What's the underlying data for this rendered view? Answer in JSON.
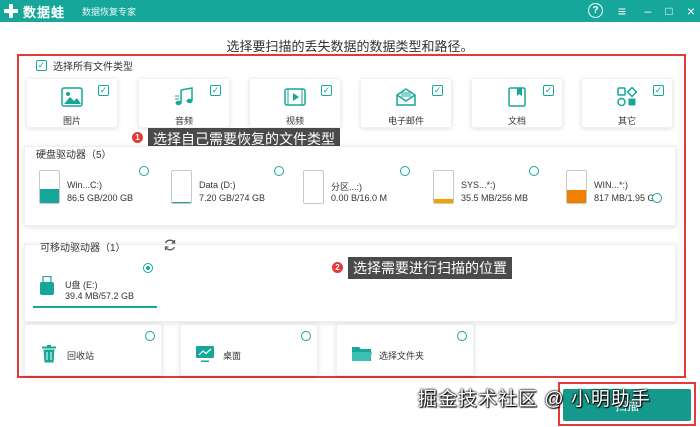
{
  "app": {
    "title": "数据蛙",
    "subtitle": "数据恢复专家"
  },
  "window_controls": {
    "help": "?",
    "menu": "≡",
    "minimize": "–",
    "maximize": "□",
    "close": "×"
  },
  "heading": "选择要扫描的丢失数据的数据类型和路径。",
  "select_all": {
    "label": "选择所有文件类型",
    "checked": true
  },
  "file_types": [
    {
      "label": "图片",
      "icon": "image-icon",
      "checked": true
    },
    {
      "label": "音频",
      "icon": "music-icon",
      "checked": true
    },
    {
      "label": "视频",
      "icon": "video-icon",
      "checked": true
    },
    {
      "label": "电子邮件",
      "icon": "email-icon",
      "checked": true
    },
    {
      "label": "文档",
      "icon": "document-icon",
      "checked": true
    },
    {
      "label": "其它",
      "icon": "other-icon",
      "checked": true
    }
  ],
  "annotation1": {
    "badge": "1",
    "text": "选择自己需要恢复的文件类型"
  },
  "annotation2": {
    "badge": "2",
    "text": "选择需要进行扫描的位置"
  },
  "hard_drives": {
    "title": "硬盘驱动器（5）",
    "items": [
      {
        "name": "Win...C:)",
        "size": "86.5 GB/200 GB",
        "fill": 0.43,
        "color": "#16a79a"
      },
      {
        "name": "Data (D:)",
        "size": "7.20 GB/274 GB",
        "fill": 0.03,
        "color": "#16a79a"
      },
      {
        "name": "分区...:)",
        "size": "0.00  B/16.0 M",
        "fill": 0.0,
        "color": "#16a79a"
      },
      {
        "name": "SYS...*:)",
        "size": "35.5 MB/256 MB",
        "fill": 0.14,
        "color": "#f5a000"
      },
      {
        "name": "WIN...*:)",
        "size": "817 MB/1.95 GB",
        "fill": 0.41,
        "color": "#f08000"
      }
    ]
  },
  "removable": {
    "title": "可移动驱动器（1）",
    "items": [
      {
        "name": "U盘 (E:)",
        "size": "39.4 MB/57.2 GB",
        "selected": true
      }
    ]
  },
  "locations": [
    {
      "label": "回收站",
      "icon": "recycle-bin-icon"
    },
    {
      "label": "桌面",
      "icon": "desktop-icon"
    },
    {
      "label": "选择文件夹",
      "icon": "folder-icon"
    }
  ],
  "watermark": "掘金技术社区 @ 小明助手",
  "scan_button": {
    "label": "扫描"
  },
  "colors": {
    "brand": "#16a79a",
    "annotation": "#e53935",
    "tooltip_bg": "#4a4a4a"
  }
}
